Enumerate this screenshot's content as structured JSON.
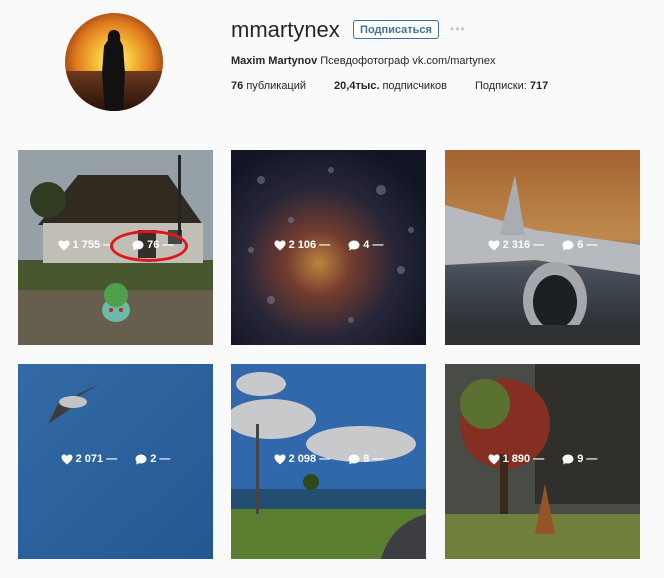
{
  "profile": {
    "username": "mmartynex",
    "follow_label": "Подписаться",
    "more_label": "•••",
    "full_name": "Maxim Martynov",
    "bio_text": "Псевдофотограф vk.com/martynex",
    "stats": {
      "posts_value": "76",
      "posts_label": "публикаций",
      "followers_value": "20,4тыс.",
      "followers_label": "подписчиков",
      "following_label": "Подписки:",
      "following_value": "717"
    }
  },
  "posts": [
    {
      "likes": "1 755 —",
      "comments": "76 —",
      "subject": "thatched-house"
    },
    {
      "likes": "2 106 —",
      "comments": "4 —",
      "subject": "raindrops-window"
    },
    {
      "likes": "2 316 —",
      "comments": "6 —",
      "subject": "airplane"
    },
    {
      "likes": "2 071 —",
      "comments": "2 —",
      "subject": "seagull"
    },
    {
      "likes": "2 098 —",
      "comments": "8 —",
      "subject": "seaside-clouds"
    },
    {
      "likes": "1 890 —",
      "comments": "9 —",
      "subject": "red-tree"
    }
  ],
  "colors": {
    "accent": "#3f729b",
    "highlight": "#e0161c"
  }
}
